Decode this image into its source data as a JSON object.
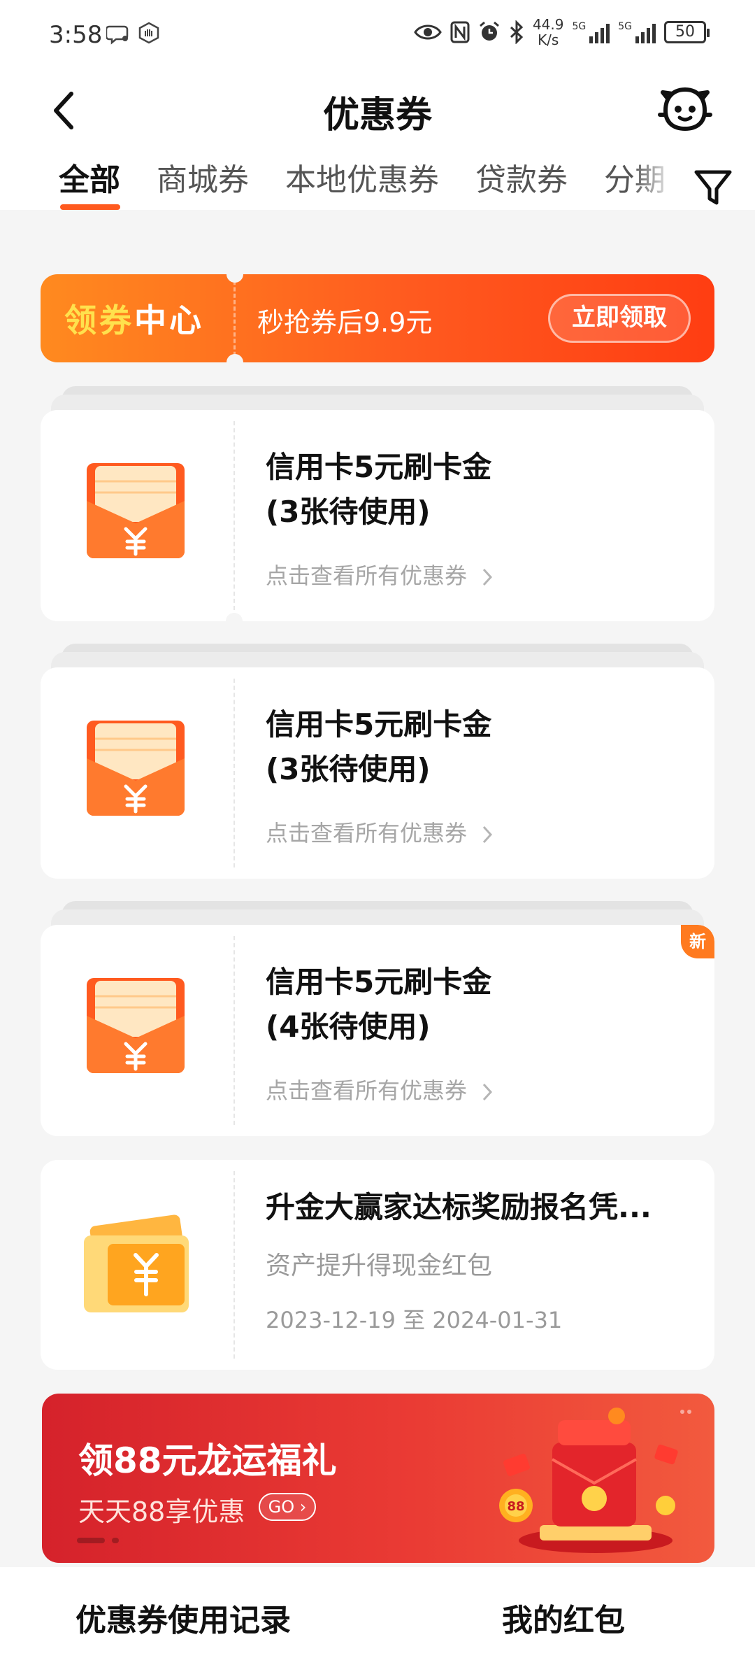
{
  "status_bar": {
    "time": "3:58",
    "net_speed_value": "44.9",
    "net_speed_unit": "K/s",
    "sim1_label": "5G",
    "sim2_label": "5G",
    "battery": "50",
    "icons": [
      "chat-bubble-icon",
      "hand-icon",
      "eye-icon",
      "nfc-icon",
      "alarm-icon",
      "bluetooth-icon"
    ]
  },
  "header": {
    "title": "优惠券",
    "back_icon": "chevron-left-icon",
    "service_icon": "customer-service-icon",
    "filter_icon": "filter-icon"
  },
  "tabs": [
    {
      "label": "全部",
      "active": true
    },
    {
      "label": "商城券",
      "active": false
    },
    {
      "label": "本地优惠券",
      "active": false
    },
    {
      "label": "贷款券",
      "active": false
    },
    {
      "label": "分期",
      "active": false
    }
  ],
  "banner": {
    "title_part1": "领券",
    "title_part2": "中心",
    "subtitle": "秒抢券后9.9元",
    "button": "立即领取"
  },
  "coupons": [
    {
      "title_line1": "信用卡5元刷卡金",
      "title_line2": "(3张待使用)",
      "link": "点击查看所有优惠券",
      "is_new": false
    },
    {
      "title_line1": "信用卡5元刷卡金",
      "title_line2": "(3张待使用)",
      "link": "点击查看所有优惠券",
      "is_new": false
    },
    {
      "title_line1": "信用卡5元刷卡金",
      "title_line2": "(4张待使用)",
      "link": "点击查看所有优惠券",
      "is_new": true,
      "badge": "新"
    }
  ],
  "voucher": {
    "title": "升金大赢家达标奖励报名凭...",
    "subtitle": "资产提升得现金红包",
    "date_range": "2023-12-19 至 2024-01-31"
  },
  "promo": {
    "title": "领88元龙运福礼",
    "subtitle": "天天88享优惠",
    "go": "GO",
    "coin_label": "88"
  },
  "bottom_bar": {
    "left": "优惠券使用记录",
    "right": "我的红包"
  },
  "colors": {
    "accent": "#ff5a1f",
    "banner_start": "#ff8a1f",
    "banner_end": "#ff3d12",
    "promo_red": "#d5222b",
    "background": "#f5f5f5"
  }
}
